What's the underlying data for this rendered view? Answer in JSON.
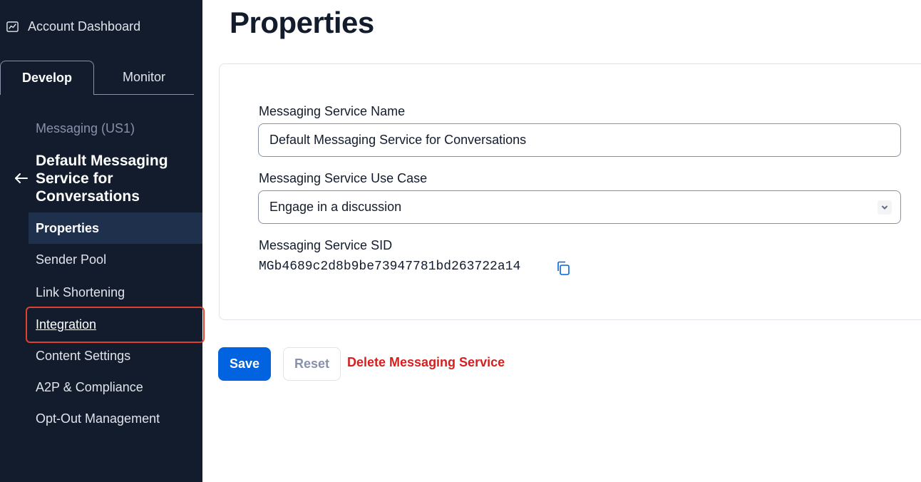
{
  "sidebar": {
    "dashboard_label": "Account Dashboard",
    "tabs": [
      {
        "label": "Develop",
        "active": true
      },
      {
        "label": "Monitor",
        "active": false
      }
    ],
    "breadcrumb_parent": "Messaging (US1)",
    "service_title": "Default Messaging Service for Conversations",
    "nav_items": [
      {
        "label": "Properties",
        "active": true
      },
      {
        "label": "Sender Pool"
      },
      {
        "label": "Link Shortening"
      },
      {
        "label": "Integration",
        "highlighted": true
      },
      {
        "label": "Content Settings"
      },
      {
        "label": "A2P & Compliance"
      },
      {
        "label": "Opt-Out Management"
      }
    ]
  },
  "main": {
    "page_title": "Properties",
    "service_name": {
      "label": "Messaging Service Name",
      "value": "Default Messaging Service for Conversations"
    },
    "use_case": {
      "label": "Messaging Service Use Case",
      "value": "Engage in a discussion"
    },
    "sid": {
      "label": "Messaging Service SID",
      "value": "MGb4689c2d8b9be73947781bd263722a14"
    },
    "actions": {
      "save": "Save",
      "reset": "Reset",
      "delete": "Delete Messaging Service"
    }
  },
  "colors": {
    "sidebar_bg": "#121c2d",
    "primary": "#0263e0",
    "destructive": "#d61f1f",
    "highlight": "#e0412e"
  }
}
